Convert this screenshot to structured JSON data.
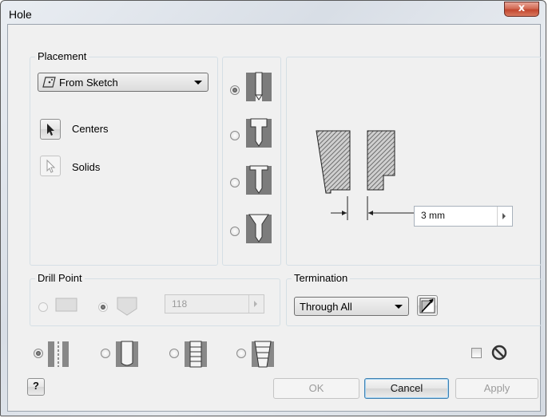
{
  "window": {
    "title": "Hole",
    "close_label": "x"
  },
  "placement": {
    "legend": "Placement",
    "dropdown_value": "From Sketch",
    "centers_label": "Centers",
    "solids_label": "Solids"
  },
  "hole_type": {
    "options": [
      "simple",
      "counterbore",
      "spotface",
      "countersink"
    ],
    "selected": "simple"
  },
  "preview": {
    "diameter_value": "3 mm"
  },
  "drill_point": {
    "legend": "Drill Point",
    "options": [
      "flat",
      "angle"
    ],
    "angle_value": "118",
    "enabled": false
  },
  "termination": {
    "legend": "Termination",
    "value": "Through All"
  },
  "thread_type": {
    "options": [
      "simple-hole",
      "clearance-hole",
      "tapped-hole",
      "taper-tapped-hole"
    ],
    "selected": "simple-hole"
  },
  "buttons": {
    "help": "?",
    "ok": "OK",
    "cancel": "Cancel",
    "apply": "Apply"
  }
}
